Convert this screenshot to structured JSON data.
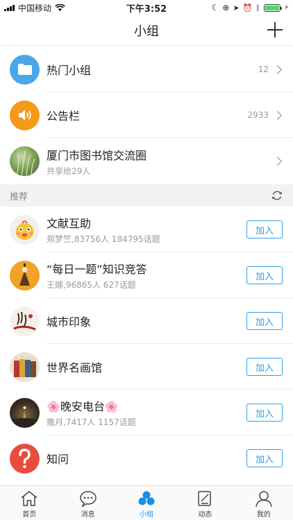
{
  "status_bar": {
    "carrier": "中国移动",
    "time": "下午3:52"
  },
  "nav": {
    "title": "小组"
  },
  "groups": [
    {
      "title": "热门小组",
      "count": "12",
      "icon": "folder-icon",
      "color": "#4aa8e8"
    },
    {
      "title": "公告栏",
      "count": "2933",
      "icon": "speaker-icon",
      "color": "#f59a1b"
    },
    {
      "title": "厦门市图书馆交流圈",
      "subtitle": "共享给29人",
      "icon": "grass-photo-icon"
    }
  ],
  "recommend": {
    "label": "推荐",
    "join_label": "加入",
    "items": [
      {
        "title": "文献互助",
        "subtitle": "郑梦竺,83756人 184795话题"
      },
      {
        "title": "“每日一题”知识竞答",
        "subtitle": "王娜,96865人 627话题"
      },
      {
        "title": "城市印象",
        "subtitle": ""
      },
      {
        "title": "世界名画馆",
        "subtitle": ""
      },
      {
        "title": "🌸晚安电台🌸",
        "subtitle": "撒月,7417人 1157话题"
      },
      {
        "title": "知问",
        "subtitle": ""
      }
    ]
  },
  "tabs": [
    {
      "label": "首页",
      "icon": "home-icon"
    },
    {
      "label": "消息",
      "icon": "chat-icon"
    },
    {
      "label": "小组",
      "icon": "group-icon",
      "active": true
    },
    {
      "label": "动态",
      "icon": "edit-icon"
    },
    {
      "label": "我的",
      "icon": "user-icon"
    }
  ],
  "colors": {
    "accent": "#1a8fe0",
    "join_border": "#2d9ee0"
  }
}
